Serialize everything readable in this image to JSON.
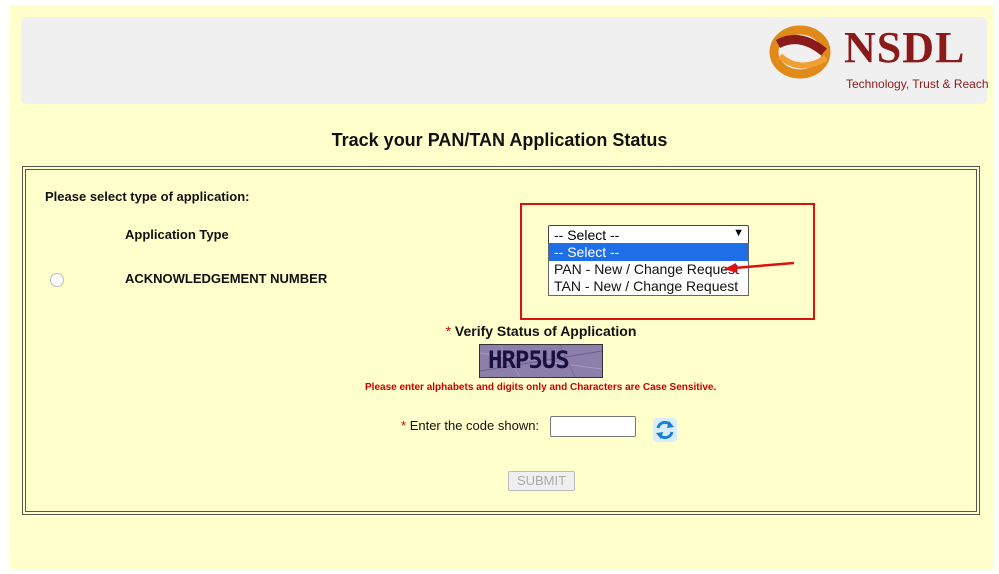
{
  "brand": {
    "name": "NSDL",
    "tagline": "Technology, Trust & Reach",
    "color": "#8b1a1a"
  },
  "page": {
    "title": "Track your PAN/TAN Application Status"
  },
  "form": {
    "select_type_prompt": "Please select type of application:",
    "application_type_label": "Application Type",
    "application_type_value": "-- Select --",
    "application_type_options": [
      "-- Select --",
      "PAN - New / Change Request",
      "TAN - New / Change Request"
    ],
    "acknowledgement_label": "ACKNOWLEDGEMENT NUMBER",
    "required_marker": "*",
    "verify_label": "Verify Status of Application",
    "captcha_text": "HRP5US",
    "captcha_note": "Please enter alphabets and digits only and Characters are Case Sensitive.",
    "code_label": "Enter the code shown:",
    "code_value": "",
    "submit_label": "SUBMIT"
  },
  "colors": {
    "page_background": "#ffffcc",
    "highlight": "#e01010",
    "selected_option": "#1e6ee8",
    "required": "#cc0000"
  },
  "icons": [
    "nsdl-logo-icon",
    "chevron-down-icon",
    "red-arrow-icon",
    "refresh-icon"
  ]
}
